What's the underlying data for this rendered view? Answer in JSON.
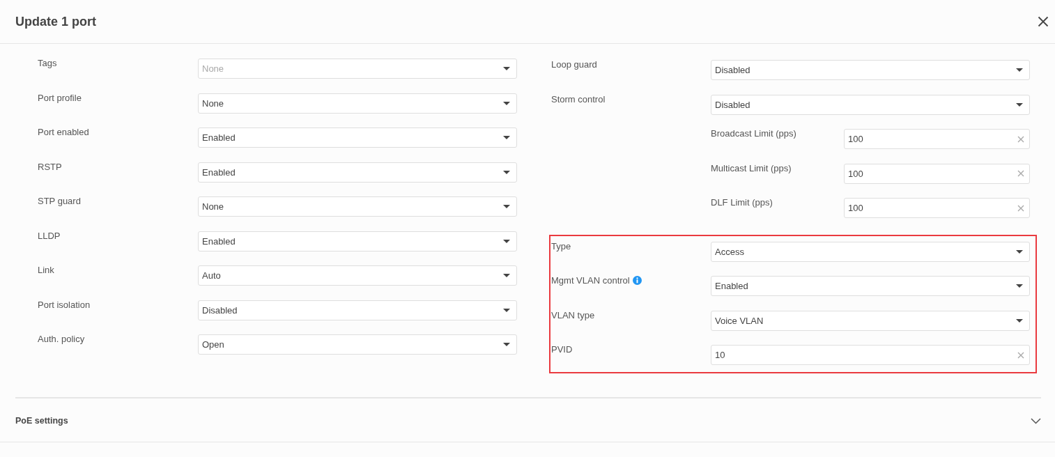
{
  "dialog": {
    "title": "Update 1 port"
  },
  "left_fields": [
    {
      "label": "Tags",
      "kind": "select",
      "value": "None",
      "disabled": true,
      "info": false
    },
    {
      "label": "Port profile",
      "kind": "select",
      "value": "None",
      "disabled": false,
      "info": false
    },
    {
      "label": "Port enabled",
      "kind": "select",
      "value": "Enabled",
      "disabled": false,
      "info": false
    },
    {
      "label": "RSTP",
      "kind": "select",
      "value": "Enabled",
      "disabled": false,
      "info": false
    },
    {
      "label": "STP guard",
      "kind": "select",
      "value": "None",
      "disabled": false,
      "info": false
    },
    {
      "label": "LLDP",
      "kind": "select",
      "value": "Enabled",
      "disabled": false,
      "info": false
    },
    {
      "label": "Link",
      "kind": "select",
      "value": "Auto",
      "disabled": false,
      "info": false
    },
    {
      "label": "Port isolation",
      "kind": "select",
      "value": "Disabled",
      "disabled": false,
      "info": false
    },
    {
      "label": "Auth. policy",
      "kind": "select",
      "value": "Open",
      "disabled": false,
      "info": false
    }
  ],
  "right_groups": [
    {
      "highlighted": false,
      "fields": [
        {
          "label": "Loop guard",
          "kind": "select",
          "value": "Disabled",
          "disabled": false,
          "info": false
        },
        {
          "label": "Storm control",
          "kind": "select",
          "value": "Disabled",
          "disabled": false,
          "info": false,
          "children": [
            {
              "label": "Broadcast Limit (pps)",
              "kind": "input",
              "value": "100",
              "disabled": false,
              "info": false
            },
            {
              "label": "Multicast Limit (pps)",
              "kind": "input",
              "value": "100",
              "disabled": false,
              "info": false
            },
            {
              "label": "DLF Limit (pps)",
              "kind": "input",
              "value": "100",
              "disabled": false,
              "info": false
            }
          ]
        }
      ]
    },
    {
      "highlighted": true,
      "fields": [
        {
          "label": "Type",
          "kind": "select",
          "value": "Access",
          "disabled": false,
          "info": false
        },
        {
          "label": "Mgmt VLAN control",
          "kind": "select",
          "value": "Enabled",
          "disabled": false,
          "info": true
        },
        {
          "label": "VLAN type",
          "kind": "select",
          "value": "Voice VLAN",
          "disabled": false,
          "info": false
        },
        {
          "label": "PVID",
          "kind": "input",
          "value": "10",
          "disabled": false,
          "info": false
        }
      ]
    }
  ],
  "sections": [
    {
      "title": "PoE settings",
      "expanded": false
    }
  ]
}
